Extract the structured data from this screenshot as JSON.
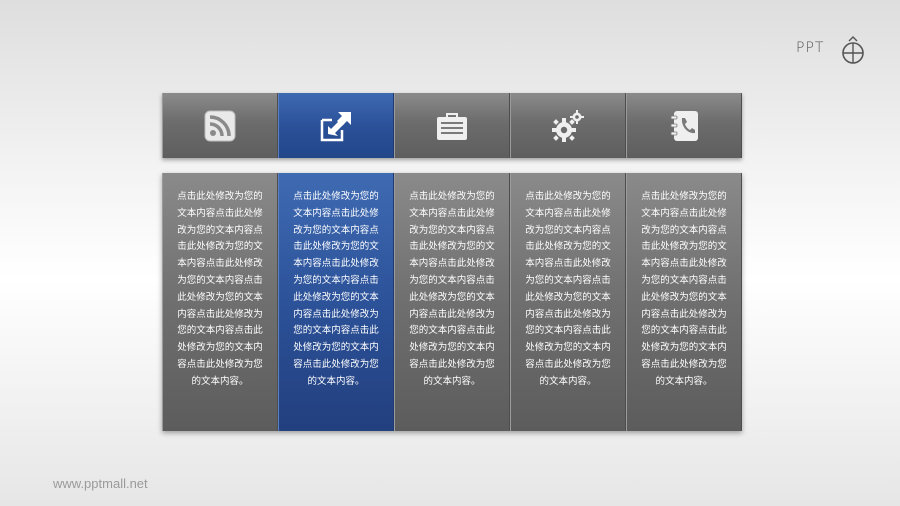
{
  "logo": {
    "text": "PPT",
    "icon": "pen-tip-globe-icon"
  },
  "icons": [
    {
      "name": "rss-icon",
      "active": false
    },
    {
      "name": "share-arrows-icon",
      "active": true
    },
    {
      "name": "briefcase-icon",
      "active": false
    },
    {
      "name": "gears-icon",
      "active": false
    },
    {
      "name": "contact-book-icon",
      "active": false
    }
  ],
  "columns": [
    {
      "text": "点击此处修改为您的文本内容点击此处修改为您的文本内容点击此处修改为您的文本内容点击此处修改为您的文本内容点击此处修改为您的文本内容点击此处修改为您的文本内容点击此处修改为您的文本内容点击此处修改为您的文本内容。"
    },
    {
      "text": "点击此处修改为您的文本内容点击此处修改为您的文本内容点击此处修改为您的文本内容点击此处修改为您的文本内容点击此处修改为您的文本内容点击此处修改为您的文本内容点击此处修改为您的文本内容点击此处修改为您的文本内容。"
    },
    {
      "text": "点击此处修改为您的文本内容点击此处修改为您的文本内容点击此处修改为您的文本内容点击此处修改为您的文本内容点击此处修改为您的文本内容点击此处修改为您的文本内容点击此处修改为您的文本内容点击此处修改为您的文本内容。"
    },
    {
      "text": "点击此处修改为您的文本内容点击此处修改为您的文本内容点击此处修改为您的文本内容点击此处修改为您的文本内容点击此处修改为您的文本内容点击此处修改为您的文本内容点击此处修改为您的文本内容点击此处修改为您的文本内容。"
    },
    {
      "text": "点击此处修改为您的文本内容点击此处修改为您的文本内容点击此处修改为您的文本内容点击此处修改为您的文本内容点击此处修改为您的文本内容点击此处修改为您的文本内容点击此处修改为您的文本内容点击此处修改为您的文本内容。"
    }
  ],
  "footer": {
    "website": "www.pptmall.net"
  },
  "colors": {
    "active": "#2b5199",
    "inactive": "#6c6c6c"
  }
}
